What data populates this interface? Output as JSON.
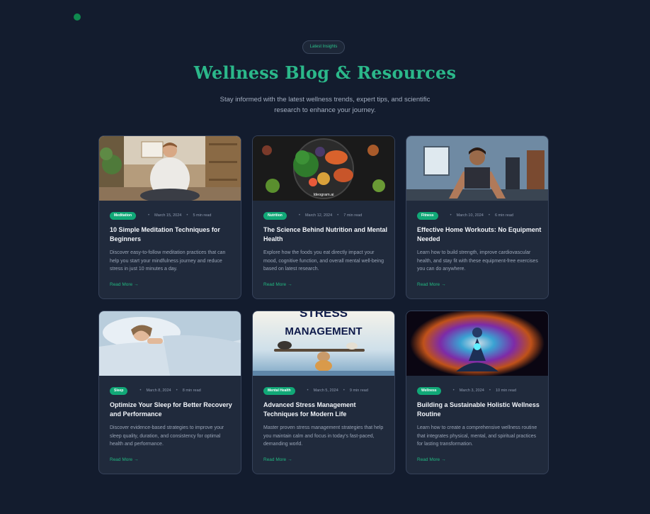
{
  "header": {
    "badge": "Latest Insights",
    "title": "Wellness Blog & Resources",
    "subtitle": "Stay informed with the latest wellness trends, expert tips, and scientific research to enhance your journey."
  },
  "colors": {
    "background": "#131c2e",
    "card": "#202a3c",
    "accent": "#2bb88a",
    "tag": "#11a877"
  },
  "separator": "•",
  "posts": [
    {
      "tag": "Meditation",
      "date": "March 15, 2024",
      "read_time": "5 min read",
      "title": "10 Simple Meditation Techniques for Beginners",
      "description": "Discover easy-to-follow meditation practices that can help you start your mindfulness journey and reduce stress in just 10 minutes a day.",
      "read_more": "Read More",
      "arrow": "→",
      "image": "man-meditating-photo"
    },
    {
      "tag": "Nutrition",
      "date": "March 12, 2024",
      "read_time": "7 min read",
      "title": "The Science Behind Nutrition and Mental Health",
      "description": "Explore how the foods you eat directly impact your mood, cognitive function, and overall mental well-being based on latest research.",
      "read_more": "Read More",
      "arrow": "→",
      "image": "healthy-food-plate-photo",
      "image_caption": "Ideogram.ai"
    },
    {
      "tag": "Fitness",
      "date": "March 10, 2024",
      "read_time": "6 min read",
      "title": "Effective Home Workouts: No Equipment Needed",
      "description": "Learn how to build strength, improve cardiovascular health, and stay fit with these equipment-free exercises you can do anywhere.",
      "read_more": "Read More",
      "arrow": "→",
      "image": "home-workout-photo"
    },
    {
      "tag": "Sleep",
      "date": "March 8, 2024",
      "read_time": "8 min read",
      "title": "Optimize Your Sleep for Better Recovery and Performance",
      "description": "Discover evidence-based strategies to improve your sleep quality, duration, and consistency for optimal health and performance.",
      "read_more": "Read More",
      "arrow": "→",
      "image": "woman-sleeping-photo"
    },
    {
      "tag": "Mental Health",
      "date": "March 5, 2024",
      "read_time": "9 min read",
      "title": "Advanced Stress Management Techniques for Modern Life",
      "description": "Master proven stress management strategies that help you maintain calm and focus in today's fast-paced, demanding world.",
      "read_more": "Read More",
      "arrow": "→",
      "image": "stress-management-balance-photo",
      "image_text_1": "STRESS",
      "image_text_2": "MANAGEMENT"
    },
    {
      "tag": "Wellness",
      "date": "March 3, 2024",
      "read_time": "10 min read",
      "title": "Building a Sustainable Holistic Wellness Routine",
      "description": "Learn how to create a comprehensive wellness routine that integrates physical, mental, and spiritual practices for lasting transformation.",
      "read_more": "Read More",
      "arrow": "→",
      "image": "chakra-meditation-photo"
    }
  ]
}
